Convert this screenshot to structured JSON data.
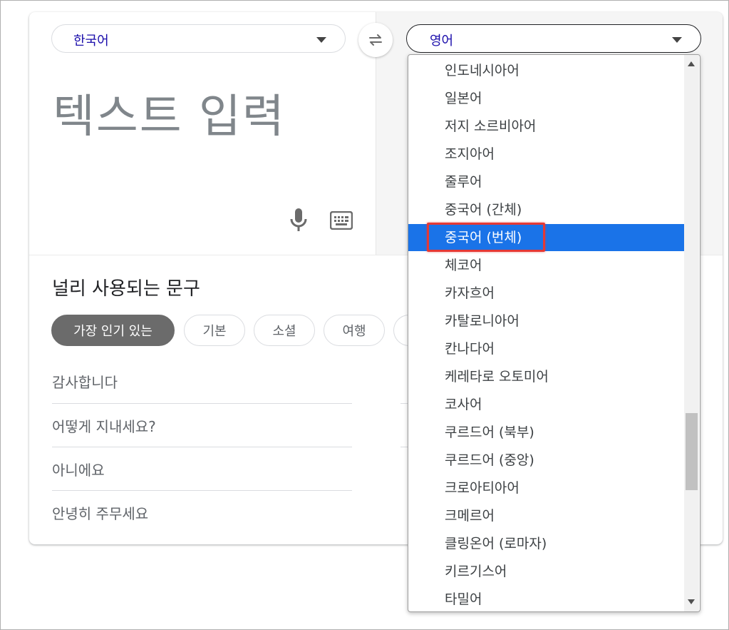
{
  "source_lang": {
    "label": "한국어"
  },
  "target_lang": {
    "label": "영어"
  },
  "input": {
    "placeholder": "텍스트 입력"
  },
  "phrases": {
    "title": "널리 사용되는 문구",
    "chips": [
      "가장 인기 있는",
      "기본",
      "소셜",
      "여행"
    ],
    "items": [
      "감사합니다",
      "어떻게 지내세요?",
      "아니에요",
      "안녕히 주무세요"
    ]
  },
  "dropdown": {
    "items": [
      "인도네시아어",
      "일본어",
      "저지 소르비아어",
      "조지아어",
      "줄루어",
      "중국어 (간체)",
      "중국어 (번체)",
      "체코어",
      "카자흐어",
      "카탈로니아어",
      "칸나다어",
      "케레타로 오토미어",
      "코사어",
      "쿠르드어 (북부)",
      "쿠르드어 (중앙)",
      "크로아티아어",
      "크메르어",
      "클링온어 (로마자)",
      "키르기스어",
      "타밀어"
    ],
    "selected_index": 6
  },
  "colors": {
    "accent": "#1a73e8",
    "highlight_border": "#e53935"
  },
  "icons": [
    "caret-down-icon",
    "swap-icon",
    "microphone-icon",
    "keyboard-icon"
  ]
}
